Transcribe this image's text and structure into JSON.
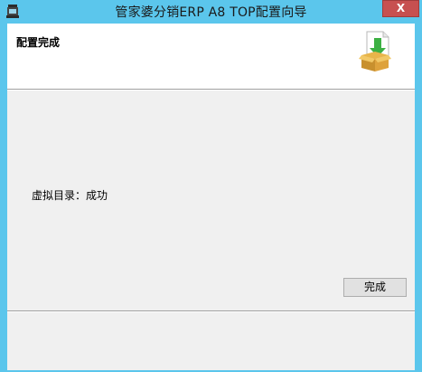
{
  "window": {
    "title": "管家婆分销ERP A8 TOP配置向导",
    "close_label": "X",
    "frame_color": "#5bc6ec",
    "close_color": "#c75050"
  },
  "header": {
    "title": "配置完成",
    "icon": "box-download-icon"
  },
  "content": {
    "status_text": "虚拟目录：成功"
  },
  "footer": {
    "finish_label": "完成"
  }
}
